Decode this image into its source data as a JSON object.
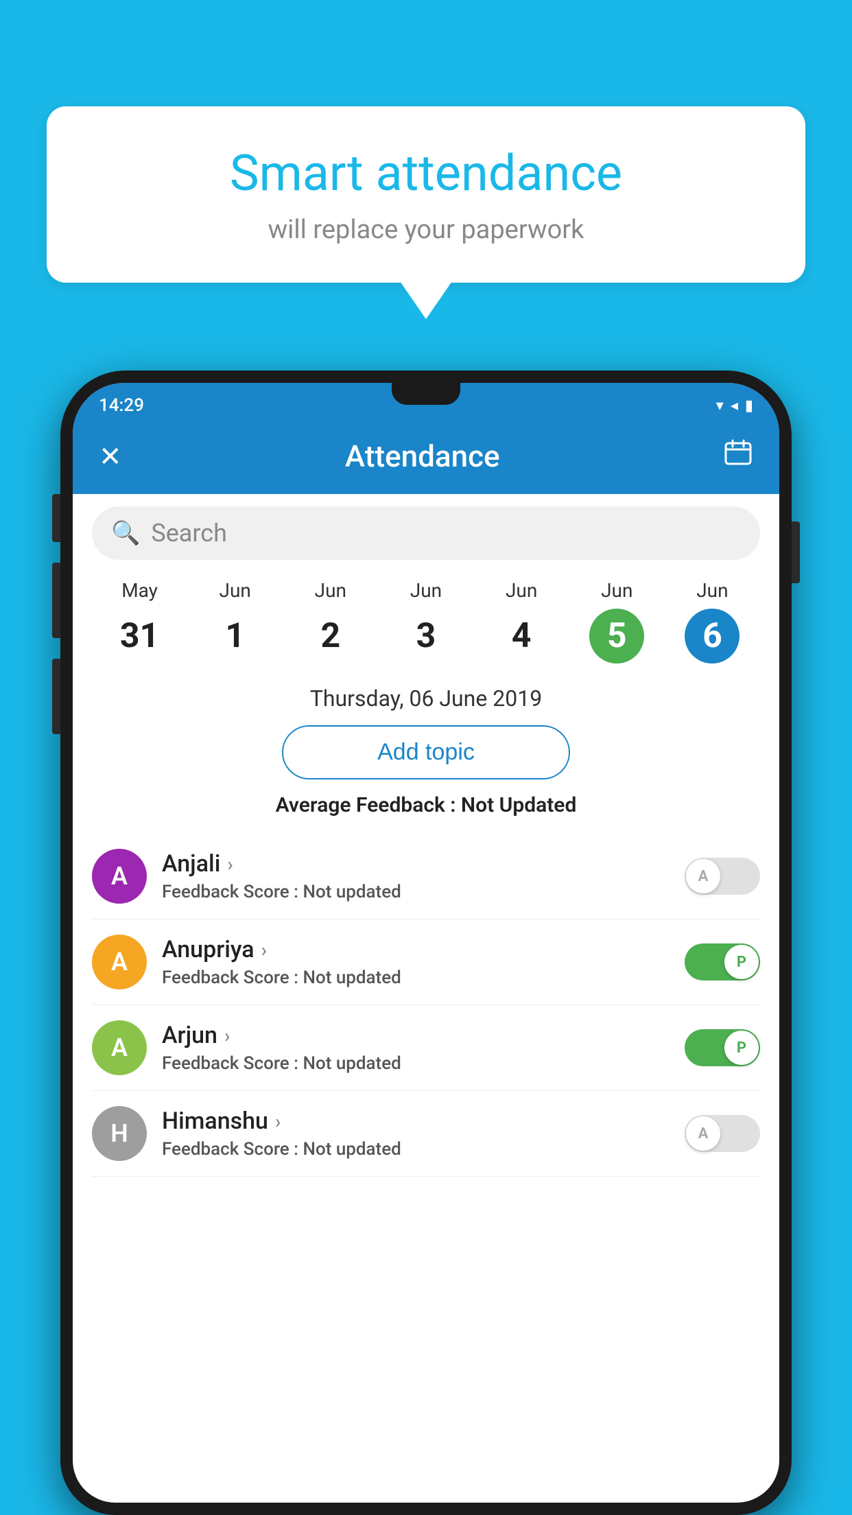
{
  "background_color": "#1ab8e8",
  "speech_bubble": {
    "title": "Smart attendance",
    "subtitle": "will replace your paperwork"
  },
  "status_bar": {
    "time": "14:29",
    "icons": [
      "wifi",
      "signal",
      "battery"
    ]
  },
  "top_bar": {
    "close_label": "✕",
    "title": "Attendance",
    "calendar_icon": "📅"
  },
  "search": {
    "placeholder": "Search"
  },
  "dates": [
    {
      "month": "May",
      "day": "31",
      "style": "normal"
    },
    {
      "month": "Jun",
      "day": "1",
      "style": "normal"
    },
    {
      "month": "Jun",
      "day": "2",
      "style": "normal"
    },
    {
      "month": "Jun",
      "day": "3",
      "style": "normal"
    },
    {
      "month": "Jun",
      "day": "4",
      "style": "normal"
    },
    {
      "month": "Jun",
      "day": "5",
      "style": "today"
    },
    {
      "month": "Jun",
      "day": "6",
      "style": "selected"
    }
  ],
  "selected_date_label": "Thursday, 06 June 2019",
  "add_topic_label": "Add topic",
  "avg_feedback_label": "Average Feedback : ",
  "avg_feedback_value": "Not Updated",
  "students": [
    {
      "name": "Anjali",
      "avatar_letter": "A",
      "avatar_color": "#9c27b0",
      "feedback_label": "Feedback Score : ",
      "feedback_value": "Not updated",
      "toggle_state": "off",
      "toggle_letter": "A"
    },
    {
      "name": "Anupriya",
      "avatar_letter": "A",
      "avatar_color": "#f5a623",
      "feedback_label": "Feedback Score : ",
      "feedback_value": "Not updated",
      "toggle_state": "on",
      "toggle_letter": "P"
    },
    {
      "name": "Arjun",
      "avatar_letter": "A",
      "avatar_color": "#8bc34a",
      "feedback_label": "Feedback Score : ",
      "feedback_value": "Not updated",
      "toggle_state": "on",
      "toggle_letter": "P"
    },
    {
      "name": "Himanshu",
      "avatar_letter": "H",
      "avatar_color": "#9e9e9e",
      "feedback_label": "Feedback Score : ",
      "feedback_value": "Not updated",
      "toggle_state": "off",
      "toggle_letter": "A"
    }
  ]
}
